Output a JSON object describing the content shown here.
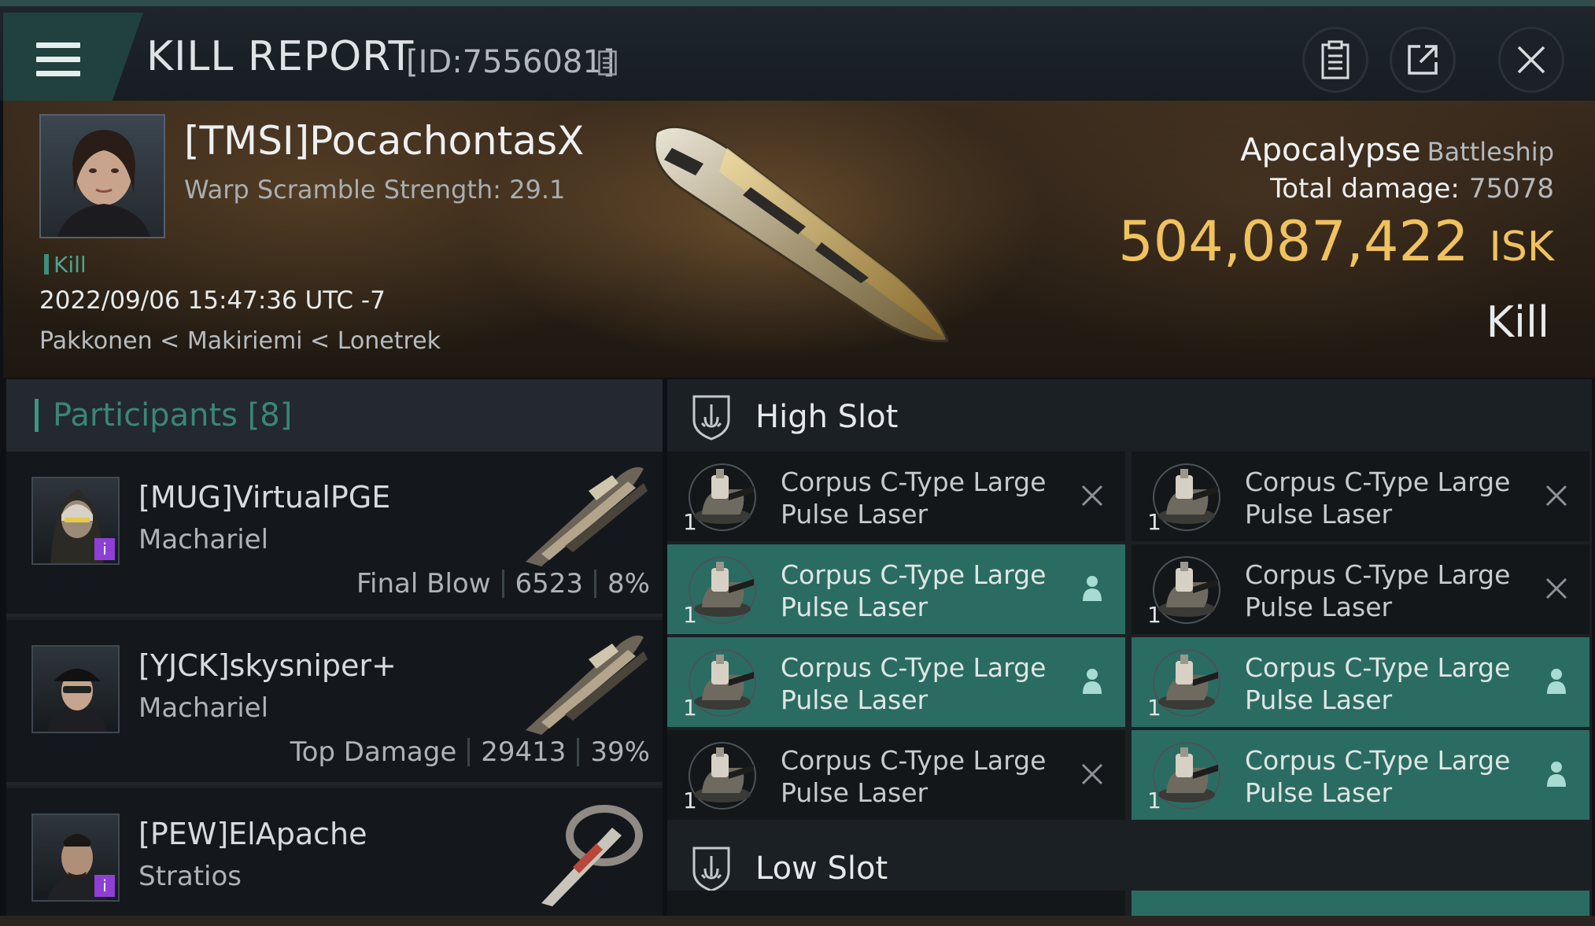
{
  "header": {
    "title": "KILL REPORT",
    "id_text": "[ID:7556081]",
    "icons": [
      "menu-icon",
      "copy-icon",
      "clipboard-icon",
      "share-icon",
      "close-icon"
    ]
  },
  "victim": {
    "name": "[TMSI]PocachontasX",
    "warp_scramble": "Warp Scramble Strength: 29.1",
    "tag": "Kill",
    "datetime": "2022/09/06 15:47:36 UTC -7",
    "location": "Pakkonen < Makiriemi < Lonetrek",
    "ship_name": "Apocalypse",
    "ship_class": "Battleship",
    "total_damage_label": "Total damage:",
    "total_damage_value": "75078",
    "isk_value": "504,087,422",
    "isk_unit": "ISK",
    "result": "Kill"
  },
  "participants": {
    "header": "Participants [8]",
    "rows": [
      {
        "name": "[MUG]VirtualPGE",
        "ship": "Machariel",
        "role": "Final Blow",
        "damage": "6523",
        "percent": "8%",
        "badge": "i"
      },
      {
        "name": "[YJCK]skysniper+",
        "ship": "Machariel",
        "role": "Top Damage",
        "damage": "29413",
        "percent": "39%",
        "badge": ""
      },
      {
        "name": "[PEW]ElApache",
        "ship": "Stratios",
        "role": "",
        "damage": "",
        "percent": "",
        "badge": "i"
      }
    ]
  },
  "fitting": {
    "high_slot_label": "High Slot",
    "low_slot_label": "Low Slot",
    "high_modules": [
      {
        "name": "Corpus C-Type Large Pulse Laser",
        "qty": "1",
        "status": "destroyed",
        "active": false
      },
      {
        "name": "Corpus C-Type Large Pulse Laser",
        "qty": "1",
        "status": "destroyed",
        "active": false
      },
      {
        "name": "Corpus C-Type Large Pulse Laser",
        "qty": "1",
        "status": "dropped",
        "active": true
      },
      {
        "name": "Corpus C-Type Large Pulse Laser",
        "qty": "1",
        "status": "destroyed",
        "active": false
      },
      {
        "name": "Corpus C-Type Large Pulse Laser",
        "qty": "1",
        "status": "dropped",
        "active": true
      },
      {
        "name": "Corpus C-Type Large Pulse Laser",
        "qty": "1",
        "status": "dropped",
        "active": true
      },
      {
        "name": "Corpus C-Type Large Pulse Laser",
        "qty": "1",
        "status": "destroyed",
        "active": false
      },
      {
        "name": "Corpus C-Type Large Pulse Laser",
        "qty": "1",
        "status": "dropped",
        "active": true
      }
    ]
  },
  "colors": {
    "accent_teal": "#2b6c62",
    "isk_gold": "#f0c25e",
    "badge_purple": "#8e3fd6"
  }
}
